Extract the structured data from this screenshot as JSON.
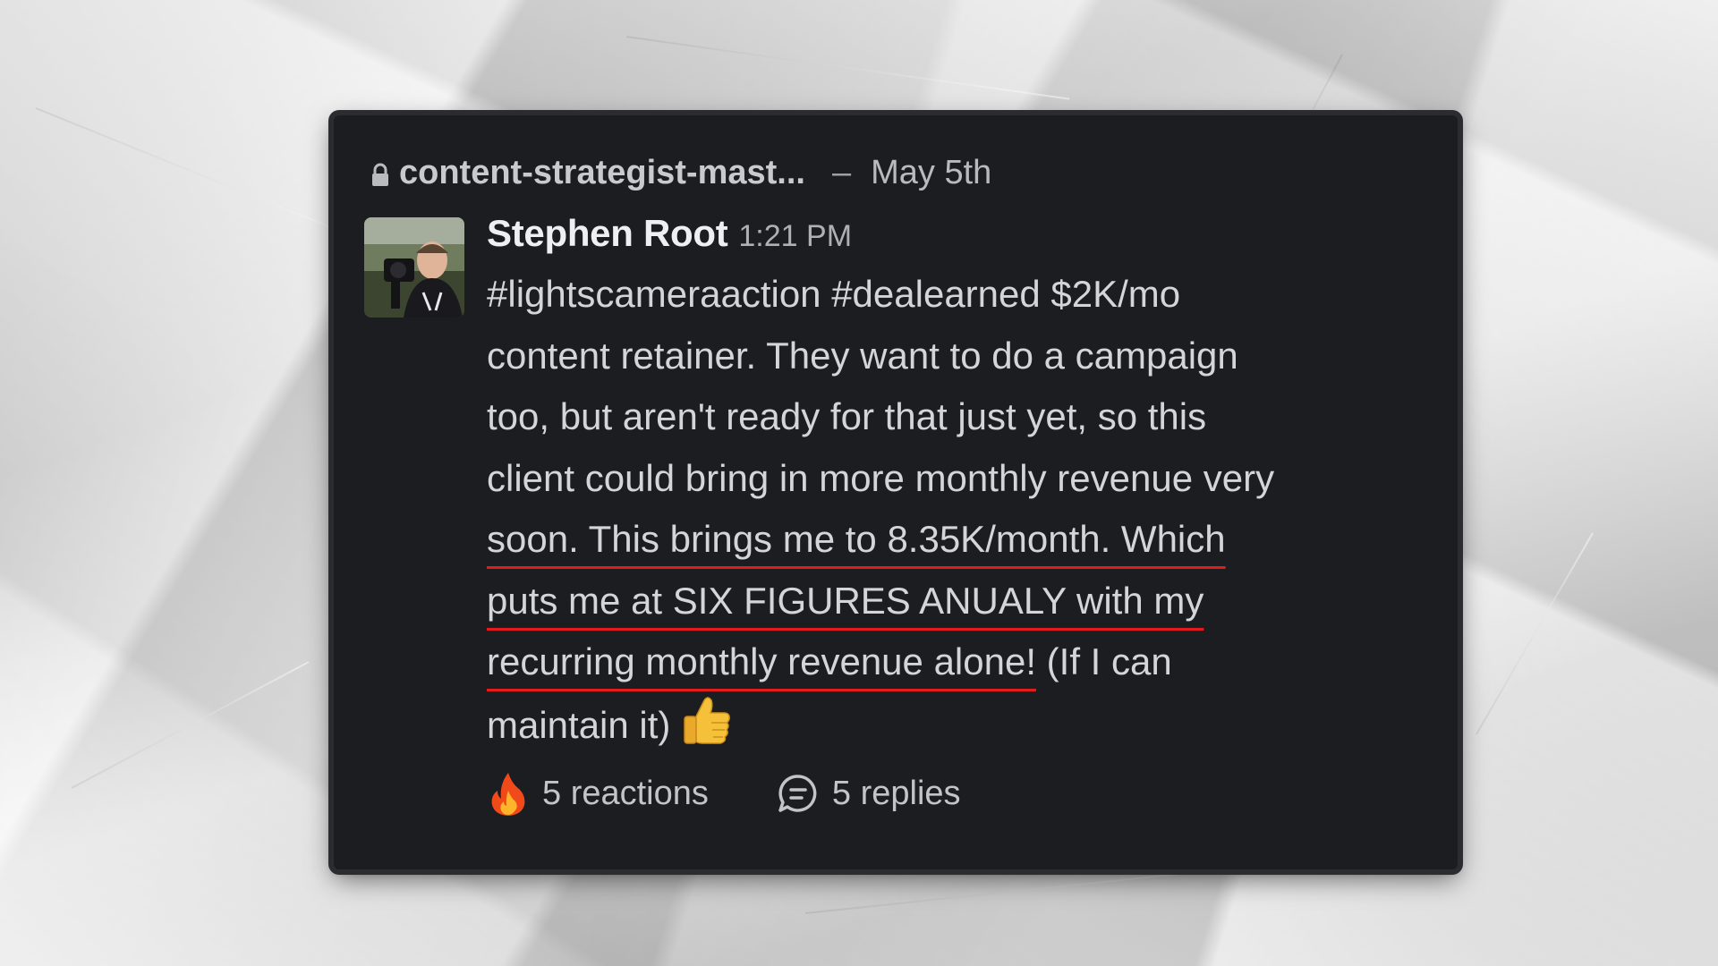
{
  "post": {
    "channel_name": "content-strategist-mast...",
    "separator": "–",
    "date": "May 5th",
    "author": "Stephen Root",
    "time": "1:21 PM",
    "message_lines": [
      "#lightscameraaction #dealearned $2K/mo",
      "content retainer. They want to do a campaign",
      "too, but aren't ready for that just yet, so this",
      "client could bring in more monthly revenue very"
    ],
    "highlighted_lines": [
      "soon. This brings me to 8.35K/month. Which",
      "puts me at SIX FIGURES ANUALY with my",
      "recurring monthly revenue alone!"
    ],
    "after_highlight": " (If I can",
    "last_line": "maintain it)",
    "reactions_label": "5 reactions",
    "replies_label": "5 replies"
  },
  "icons": {
    "lock": "lock-icon",
    "thumb": "thumbs-up-icon",
    "fire": "fire-icon",
    "replies": "speech-bubble-icon"
  },
  "colors": {
    "card_background": "#1b1d21",
    "highlight_underline": "#e21b1b"
  }
}
